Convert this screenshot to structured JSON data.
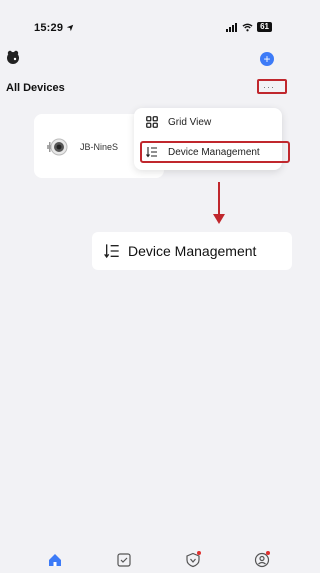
{
  "status_bar": {
    "time": "15:29",
    "battery": "61"
  },
  "header": {
    "title": "All Devices",
    "more_label": "···"
  },
  "devices": [
    {
      "name": "JB-NineS"
    }
  ],
  "menu": {
    "items": [
      {
        "label": "Grid View",
        "icon": "grid-icon"
      },
      {
        "label": "Device Management",
        "icon": "sort-list-icon"
      }
    ]
  },
  "callout": {
    "label": "Device Management",
    "icon": "sort-list-icon"
  },
  "colors": {
    "accent": "#3d7bf7",
    "highlight": "#c0272d",
    "background": "#f2f2f5"
  }
}
